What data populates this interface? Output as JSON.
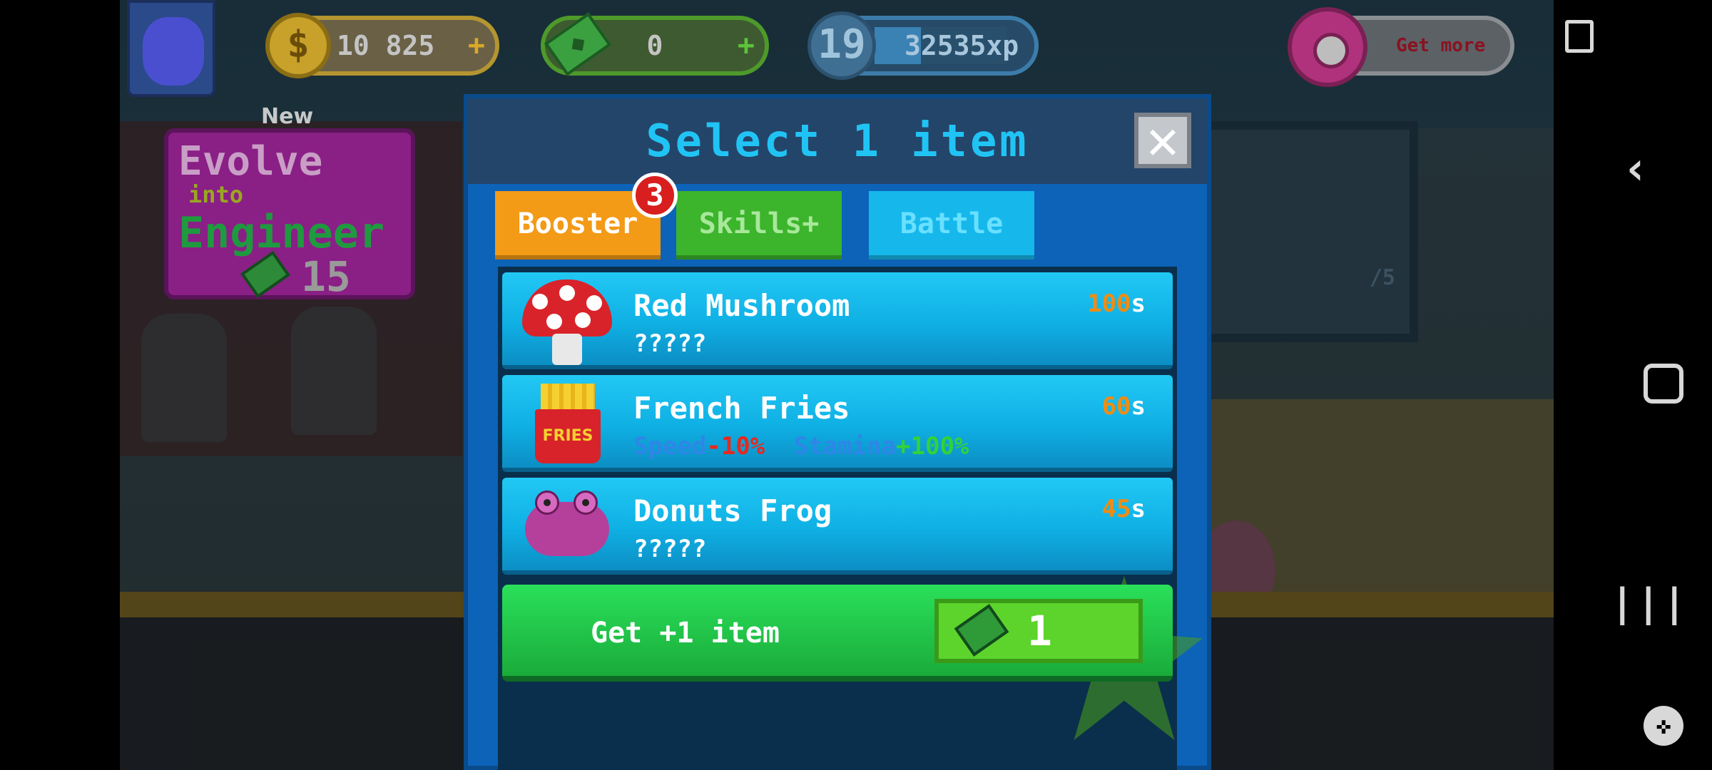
{
  "hud": {
    "coins": "10 825",
    "coins_plus": "+",
    "cash": "0",
    "cash_plus": "+",
    "level": "19",
    "xp": "32535xp",
    "xp_progress": 0.35,
    "donut_button": "Get more"
  },
  "evolve": {
    "new_label": "New",
    "title": "Evolve",
    "into": "into",
    "target": "Engineer",
    "cost": "15"
  },
  "dialog": {
    "title": "Select 1 item",
    "close_symbol": "✕",
    "tabs": [
      {
        "label": "Booster",
        "badge": "3",
        "active": true
      },
      {
        "label": "Skills+"
      },
      {
        "label": "Battle"
      }
    ],
    "items": [
      {
        "name": "Red Mushroom",
        "desc": "?????",
        "time": "100",
        "unit": "s",
        "icon": "red-mushroom-icon"
      },
      {
        "name": "French Fries",
        "stat1_label": "Speed",
        "stat1_value": "-10%",
        "stat2_label": "Stamina",
        "stat2_value": "+100%",
        "time": "60",
        "unit": "s",
        "icon": "french-fries-icon",
        "fries_text": "FRIES"
      },
      {
        "name": "Donuts Frog",
        "desc": "?????",
        "time": "45",
        "unit": "s",
        "icon": "donuts-frog-icon"
      }
    ],
    "get_more": {
      "label": "Get +1 item",
      "cost": "1"
    }
  },
  "background": {
    "board_text": "/5"
  },
  "navbar": {
    "back": "‹",
    "recent": "|||",
    "game": "✜"
  }
}
